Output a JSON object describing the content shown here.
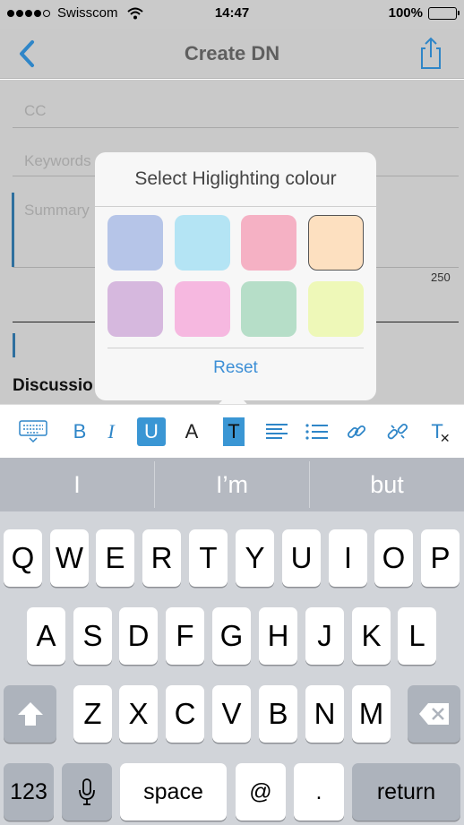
{
  "status_bar": {
    "carrier": "Swisscom",
    "time": "14:47",
    "battery": "100%"
  },
  "nav": {
    "title": "Create DN",
    "back_icon": "chevron-left-icon",
    "share_icon": "share-icon"
  },
  "form": {
    "cc_placeholder": "CC",
    "keywords_placeholder": "Keywords",
    "summary_placeholder": "Summary",
    "summary_counter": "250",
    "discussion_label": "Discussio"
  },
  "popover": {
    "title": "Select Higlighting colour",
    "swatches": [
      "#b6c5e8",
      "#b4e4f4",
      "#f5b1c4",
      "#fde0c0",
      "#d6b8de",
      "#f6b8e0",
      "#b6dec8",
      "#eef8b8"
    ],
    "selected_index": 3,
    "reset_label": "Reset"
  },
  "toolbar": {
    "items": [
      "keyboard-hide-icon",
      "bold-icon",
      "italic-icon",
      "underline-icon",
      "font-color-icon",
      "highlight-icon",
      "align-icon",
      "list-icon",
      "link-icon",
      "unlink-icon",
      "clear-format-icon"
    ],
    "bold": "B",
    "italic": "I",
    "underline": "U",
    "font_color": "A",
    "highlight": "T",
    "clear_format": "T"
  },
  "keyboard": {
    "suggestions": [
      "I",
      "I’m",
      "but"
    ],
    "row1": [
      "Q",
      "W",
      "E",
      "R",
      "T",
      "Y",
      "U",
      "I",
      "O",
      "P"
    ],
    "row2": [
      "A",
      "S",
      "D",
      "F",
      "G",
      "H",
      "J",
      "K",
      "L"
    ],
    "row3": [
      "Z",
      "X",
      "C",
      "V",
      "B",
      "N",
      "M"
    ],
    "numbers_key": "123",
    "space_key": "space",
    "at_key": "@",
    "dot_key": ".",
    "return_key": "return"
  },
  "colors": {
    "accent": "#2f86c8",
    "dim_overlay": "#c9c9c9"
  }
}
